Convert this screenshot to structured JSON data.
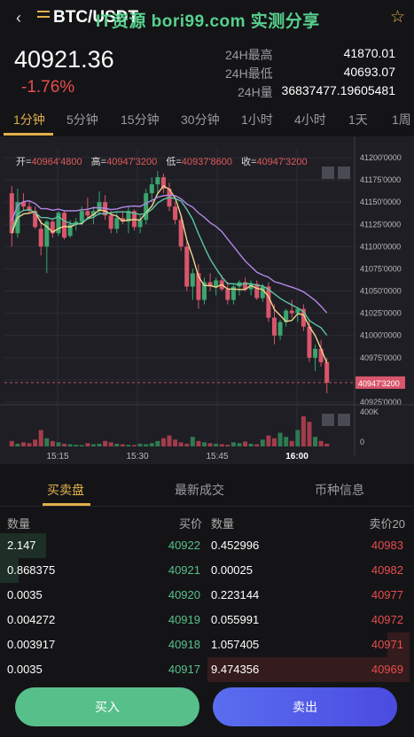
{
  "header": {
    "back_glyph": "‹",
    "pair": "BTC/USDT",
    "watermark": "IT资源 bori99.com 实测分享",
    "star_glyph": "☆"
  },
  "ticker": {
    "last": "40921.36",
    "change": "-1.76%",
    "high_label": "24H最高",
    "high_value": "41870.01",
    "low_label": "24H最低",
    "low_value": "40693.07",
    "vol_label": "24H量",
    "vol_value": "36837477.19605481"
  },
  "periods": [
    "1分钟",
    "5分钟",
    "15分钟",
    "30分钟",
    "1小时",
    "4小时",
    "1天",
    "1周"
  ],
  "chart_data": {
    "type": "candlestick",
    "ohlc_labels": {
      "open_label": "开=",
      "open": "40964'4800",
      "high_label": "高=",
      "high": "40947'3200",
      "low_label": "低=",
      "low": "40937'8600",
      "close_label": "收=",
      "close": "40947'3200"
    },
    "price_ticks": [
      "41200'0000",
      "41175'0000",
      "41150'0000",
      "41125'0000",
      "41100'0000",
      "41075'0000",
      "41050'0000",
      "41025'0000",
      "41000'0000",
      "40975'0000",
      "40950'0000",
      "40925'0000"
    ],
    "price_tag": "40947'3200",
    "volume_ticks": [
      "400K",
      "0"
    ],
    "time_ticks": [
      "15:15",
      "15:30",
      "15:45",
      "16:00"
    ],
    "ylim": [
      40925,
      41200
    ],
    "candles": [
      [
        41160,
        41168,
        41100,
        41115
      ],
      [
        41115,
        41165,
        41110,
        41150
      ],
      [
        41150,
        41160,
        41140,
        41145
      ],
      [
        41145,
        41150,
        41138,
        41140
      ],
      [
        41140,
        41145,
        41120,
        41122
      ],
      [
        41120,
        41130,
        41090,
        41100
      ],
      [
        41100,
        41130,
        41070,
        41128
      ],
      [
        41128,
        41130,
        41110,
        41115
      ],
      [
        41115,
        41140,
        41112,
        41138
      ],
      [
        41138,
        41140,
        41108,
        41110
      ],
      [
        41112,
        41130,
        41110,
        41125
      ],
      [
        41125,
        41132,
        41118,
        41128
      ],
      [
        41128,
        41145,
        41124,
        41140
      ],
      [
        41140,
        41155,
        41130,
        41135
      ],
      [
        41135,
        41145,
        41125,
        41140
      ],
      [
        41140,
        41162,
        41135,
        41150
      ],
      [
        41150,
        41158,
        41130,
        41135
      ],
      [
        41135,
        41140,
        41115,
        41120
      ],
      [
        41120,
        41138,
        41115,
        41132
      ],
      [
        41132,
        41140,
        41125,
        41128
      ],
      [
        41128,
        41145,
        41115,
        41140
      ],
      [
        41140,
        41142,
        41118,
        41122
      ],
      [
        41122,
        41135,
        41115,
        41130
      ],
      [
        41130,
        41165,
        41125,
        41160
      ],
      [
        41160,
        41178,
        41150,
        41170
      ],
      [
        41170,
        41185,
        41160,
        41178
      ],
      [
        41178,
        41182,
        41160,
        41165
      ],
      [
        41165,
        41172,
        41140,
        41145
      ],
      [
        41145,
        41150,
        41125,
        41130
      ],
      [
        41130,
        41135,
        41095,
        41100
      ],
      [
        41100,
        41105,
        41050,
        41055
      ],
      [
        41055,
        41075,
        41040,
        41070
      ],
      [
        41070,
        41080,
        41030,
        41040
      ],
      [
        41040,
        41065,
        41035,
        41060
      ],
      [
        41060,
        41070,
        41050,
        41055
      ],
      [
        41055,
        41065,
        41045,
        41062
      ],
      [
        41062,
        41068,
        41050,
        41052
      ],
      [
        41052,
        41060,
        41035,
        41040
      ],
      [
        41040,
        41058,
        41035,
        41055
      ],
      [
        41055,
        41062,
        41045,
        41060
      ],
      [
        41060,
        41065,
        41050,
        41052
      ],
      [
        41052,
        41062,
        41045,
        41058
      ],
      [
        41058,
        41062,
        41040,
        41042
      ],
      [
        41042,
        41058,
        41038,
        41055
      ],
      [
        41055,
        41060,
        41015,
        41020
      ],
      [
        41020,
        41035,
        40990,
        41000
      ],
      [
        41000,
        41018,
        40995,
        41015
      ],
      [
        41015,
        41030,
        41010,
        41028
      ],
      [
        41028,
        41040,
        41020,
        41025
      ],
      [
        41025,
        41032,
        41015,
        41030
      ],
      [
        41030,
        41035,
        41005,
        41010
      ],
      [
        41010,
        41018,
        40970,
        40975
      ],
      [
        40975,
        40990,
        40960,
        40985
      ],
      [
        40985,
        40995,
        40965,
        40970
      ],
      [
        40970,
        40975,
        40935,
        40947
      ]
    ],
    "volumes": [
      20,
      10,
      15,
      12,
      25,
      60,
      30,
      20,
      15,
      10,
      8,
      6,
      5,
      12,
      8,
      10,
      20,
      15,
      10,
      8,
      6,
      5,
      10,
      8,
      12,
      20,
      30,
      40,
      25,
      15,
      10,
      35,
      20,
      15,
      12,
      10,
      8,
      6,
      15,
      12,
      18,
      10,
      8,
      25,
      40,
      30,
      50,
      35,
      20,
      60,
      110,
      90,
      35,
      20,
      10
    ],
    "ma_lines": [
      {
        "name": "ma-yellow",
        "color": "#f0d58c"
      },
      {
        "name": "ma-green",
        "color": "#5cc6a3"
      },
      {
        "name": "ma-purple",
        "color": "#b488e8"
      }
    ],
    "up_color": "#3aa56e",
    "down_color": "#d9566b"
  },
  "bottom_tabs": [
    "买卖盘",
    "最新成交",
    "币种信息"
  ],
  "orderbook": {
    "head_qty": "数量",
    "head_bid": "买价",
    "head_qty2": "数量",
    "head_ask": "卖价20",
    "rows": [
      {
        "bid_qty": "2.147",
        "bid": "40922",
        "ask_qty": "0.452996",
        "ask": "40983",
        "bid_depth": 0.23,
        "ask_depth": 0.0
      },
      {
        "bid_qty": "0.868375",
        "bid": "40921",
        "ask_qty": "0.00025",
        "ask": "40982",
        "bid_depth": 0.09,
        "ask_depth": 0.0
      },
      {
        "bid_qty": "0.0035",
        "bid": "40920",
        "ask_qty": "0.223144",
        "ask": "40977",
        "bid_depth": 0.0,
        "ask_depth": 0.0
      },
      {
        "bid_qty": "0.004272",
        "bid": "40919",
        "ask_qty": "0.055991",
        "ask": "40972",
        "bid_depth": 0.0,
        "ask_depth": 0.0
      },
      {
        "bid_qty": "0.003917",
        "bid": "40918",
        "ask_qty": "1.057405",
        "ask": "40971",
        "bid_depth": 0.0,
        "ask_depth": 0.11
      },
      {
        "bid_qty": "0.0035",
        "bid": "40917",
        "ask_qty": "9.474356",
        "ask": "40969",
        "bid_depth": 0.0,
        "ask_depth": 1.0
      }
    ]
  },
  "actions": {
    "buy": "买入",
    "sell": "卖出"
  },
  "colors": {
    "accent": "#e2b04a",
    "bid": "#57c08a",
    "ask": "#e84c4c"
  }
}
